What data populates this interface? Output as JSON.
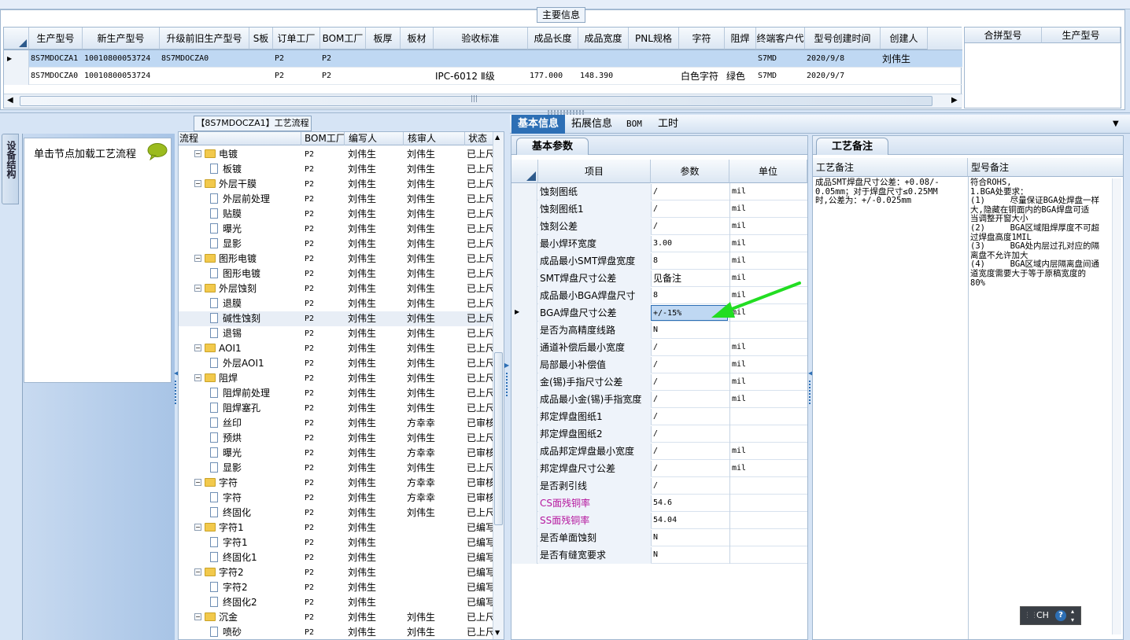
{
  "main": {
    "title": "主要信息",
    "columns": [
      "生产型号",
      "新生产型号",
      "升级前旧生产型号",
      "S板",
      "订单工厂",
      "BOM工厂",
      "板厚",
      "板材",
      "验收标准",
      "成品长度",
      "成品宽度",
      "PNL规格",
      "字符",
      "阻焊",
      "终端客户代码",
      "型号创建时间",
      "创建人"
    ],
    "rows": [
      [
        "8S7MDOCZA1",
        "10010800053724",
        "8S7MDOCZA0",
        "",
        "P2",
        "P2",
        "",
        "",
        "",
        "",
        "",
        "",
        "",
        "",
        "S7MD",
        "2020/9/8",
        "刘伟生"
      ],
      [
        "8S7MDOCZA0",
        "10010800053724",
        "",
        "",
        "P2",
        "P2",
        "",
        "",
        "IPC-6012 Ⅱ级",
        "177.000",
        "148.390",
        "",
        "白色字符",
        "绿色",
        "S7MD",
        "2020/9/7",
        ""
      ]
    ],
    "side_columns": [
      "合拼型号",
      "生产型号"
    ]
  },
  "left": {
    "vertical_tab": "设备结构",
    "hint": "单击节点加载工艺流程"
  },
  "tree": {
    "title": "【8S7MDOCZA1】工艺流程",
    "columns": [
      "流程",
      "BOM工厂",
      "编写人",
      "核审人",
      "状态"
    ],
    "rows": [
      {
        "level": 1,
        "type": "folder",
        "name": "电镀",
        "bom": "P2",
        "writer": "刘伟生",
        "reviewer": "刘伟生",
        "status": "已上尺"
      },
      {
        "level": 2,
        "type": "doc",
        "name": "板镀",
        "bom": "P2",
        "writer": "刘伟生",
        "reviewer": "刘伟生",
        "status": "已上尺"
      },
      {
        "level": 1,
        "type": "folder",
        "name": "外层干膜",
        "bom": "P2",
        "writer": "刘伟生",
        "reviewer": "刘伟生",
        "status": "已上尺"
      },
      {
        "level": 2,
        "type": "doc",
        "name": "外层前处理",
        "bom": "P2",
        "writer": "刘伟生",
        "reviewer": "刘伟生",
        "status": "已上尺"
      },
      {
        "level": 2,
        "type": "doc",
        "name": "贴膜",
        "bom": "P2",
        "writer": "刘伟生",
        "reviewer": "刘伟生",
        "status": "已上尺"
      },
      {
        "level": 2,
        "type": "doc",
        "name": "曝光",
        "bom": "P2",
        "writer": "刘伟生",
        "reviewer": "刘伟生",
        "status": "已上尺"
      },
      {
        "level": 2,
        "type": "doc",
        "name": "显影",
        "bom": "P2",
        "writer": "刘伟生",
        "reviewer": "刘伟生",
        "status": "已上尺"
      },
      {
        "level": 1,
        "type": "folder",
        "name": "图形电镀",
        "bom": "P2",
        "writer": "刘伟生",
        "reviewer": "刘伟生",
        "status": "已上尺"
      },
      {
        "level": 2,
        "type": "doc",
        "name": "图形电镀",
        "bom": "P2",
        "writer": "刘伟生",
        "reviewer": "刘伟生",
        "status": "已上尺"
      },
      {
        "level": 1,
        "type": "folder",
        "name": "外层蚀刻",
        "bom": "P2",
        "writer": "刘伟生",
        "reviewer": "刘伟生",
        "status": "已上尺"
      },
      {
        "level": 2,
        "type": "doc",
        "name": "退膜",
        "bom": "P2",
        "writer": "刘伟生",
        "reviewer": "刘伟生",
        "status": "已上尺"
      },
      {
        "level": 2,
        "type": "doc",
        "name": "碱性蚀刻",
        "bom": "P2",
        "writer": "刘伟生",
        "reviewer": "刘伟生",
        "status": "已上尺"
      },
      {
        "level": 2,
        "type": "doc",
        "name": "退锡",
        "bom": "P2",
        "writer": "刘伟生",
        "reviewer": "刘伟生",
        "status": "已上尺"
      },
      {
        "level": 1,
        "type": "folder",
        "name": "AOI1",
        "bom": "P2",
        "writer": "刘伟生",
        "reviewer": "刘伟生",
        "status": "已上尺"
      },
      {
        "level": 2,
        "type": "doc",
        "name": "外层AOI1",
        "bom": "P2",
        "writer": "刘伟生",
        "reviewer": "刘伟生",
        "status": "已上尺"
      },
      {
        "level": 1,
        "type": "folder",
        "name": "阻焊",
        "bom": "P2",
        "writer": "刘伟生",
        "reviewer": "刘伟生",
        "status": "已上尺"
      },
      {
        "level": 2,
        "type": "doc",
        "name": "阻焊前处理",
        "bom": "P2",
        "writer": "刘伟生",
        "reviewer": "刘伟生",
        "status": "已上尺"
      },
      {
        "level": 2,
        "type": "doc",
        "name": "阻焊塞孔",
        "bom": "P2",
        "writer": "刘伟生",
        "reviewer": "刘伟生",
        "status": "已上尺"
      },
      {
        "level": 2,
        "type": "doc",
        "name": "丝印",
        "bom": "P2",
        "writer": "刘伟生",
        "reviewer": "方幸幸",
        "status": "已审核"
      },
      {
        "level": 2,
        "type": "doc",
        "name": "预烘",
        "bom": "P2",
        "writer": "刘伟生",
        "reviewer": "刘伟生",
        "status": "已上尺"
      },
      {
        "level": 2,
        "type": "doc",
        "name": "曝光",
        "bom": "P2",
        "writer": "刘伟生",
        "reviewer": "方幸幸",
        "status": "已审核"
      },
      {
        "level": 2,
        "type": "doc",
        "name": "显影",
        "bom": "P2",
        "writer": "刘伟生",
        "reviewer": "刘伟生",
        "status": "已上尺"
      },
      {
        "level": 1,
        "type": "folder",
        "name": "字符",
        "bom": "P2",
        "writer": "刘伟生",
        "reviewer": "方幸幸",
        "status": "已审核"
      },
      {
        "level": 2,
        "type": "doc",
        "name": "字符",
        "bom": "P2",
        "writer": "刘伟生",
        "reviewer": "方幸幸",
        "status": "已审核"
      },
      {
        "level": 2,
        "type": "doc",
        "name": "终固化",
        "bom": "P2",
        "writer": "刘伟生",
        "reviewer": "刘伟生",
        "status": "已上尺"
      },
      {
        "level": 1,
        "type": "folder",
        "name": "字符1",
        "bom": "P2",
        "writer": "刘伟生",
        "reviewer": "",
        "status": "已编写"
      },
      {
        "level": 2,
        "type": "doc",
        "name": "字符1",
        "bom": "P2",
        "writer": "刘伟生",
        "reviewer": "",
        "status": "已编写"
      },
      {
        "level": 2,
        "type": "doc",
        "name": "终固化1",
        "bom": "P2",
        "writer": "刘伟生",
        "reviewer": "",
        "status": "已编写"
      },
      {
        "level": 1,
        "type": "folder",
        "name": "字符2",
        "bom": "P2",
        "writer": "刘伟生",
        "reviewer": "",
        "status": "已编写"
      },
      {
        "level": 2,
        "type": "doc",
        "name": "字符2",
        "bom": "P2",
        "writer": "刘伟生",
        "reviewer": "",
        "status": "已编写"
      },
      {
        "level": 2,
        "type": "doc",
        "name": "终固化2",
        "bom": "P2",
        "writer": "刘伟生",
        "reviewer": "",
        "status": "已编写"
      },
      {
        "level": 1,
        "type": "folder",
        "name": "沉金",
        "bom": "P2",
        "writer": "刘伟生",
        "reviewer": "刘伟生",
        "status": "已上尺"
      },
      {
        "level": 2,
        "type": "doc",
        "name": "喷砂",
        "bom": "P2",
        "writer": "刘伟生",
        "reviewer": "刘伟生",
        "status": "已上尺"
      }
    ]
  },
  "right_tabs": [
    "基本信息",
    "拓展信息",
    "BOM",
    "工时"
  ],
  "params": {
    "subtab": "基本参数",
    "columns": [
      "项目",
      "参数",
      "单位"
    ],
    "rows": [
      {
        "item": "蚀刻图纸",
        "value": "/",
        "unit": "mil",
        "pink": false
      },
      {
        "item": "蚀刻图纸1",
        "value": "/",
        "unit": "mil",
        "pink": false
      },
      {
        "item": "蚀刻公差",
        "value": "/",
        "unit": "mil",
        "pink": false
      },
      {
        "item": "最小焊环宽度",
        "value": "3.00",
        "unit": "mil",
        "pink": false
      },
      {
        "item": "成品最小SMT焊盘宽度",
        "value": "8",
        "unit": "mil",
        "pink": false
      },
      {
        "item": "SMT焊盘尺寸公差",
        "value": "见备注",
        "unit": "mil",
        "pink": false
      },
      {
        "item": "成品最小BGA焊盘尺寸",
        "value": "8",
        "unit": "mil",
        "pink": false
      },
      {
        "item": "BGA焊盘尺寸公差",
        "value": "+/-15%",
        "unit": "mil",
        "pink": false
      },
      {
        "item": "是否为高精度线路",
        "value": "N",
        "unit": "",
        "pink": false
      },
      {
        "item": "通道补偿后最小宽度",
        "value": "/",
        "unit": "mil",
        "pink": false
      },
      {
        "item": "局部最小补偿值",
        "value": "/",
        "unit": "mil",
        "pink": false
      },
      {
        "item": "金(锡)手指尺寸公差",
        "value": "/",
        "unit": "mil",
        "pink": false
      },
      {
        "item": "成品最小金(锡)手指宽度",
        "value": "/",
        "unit": "mil",
        "pink": false
      },
      {
        "item": "邦定焊盘图纸1",
        "value": "/",
        "unit": "",
        "pink": false
      },
      {
        "item": "邦定焊盘图纸2",
        "value": "/",
        "unit": "",
        "pink": false
      },
      {
        "item": "成品邦定焊盘最小宽度",
        "value": "/",
        "unit": "mil",
        "pink": false
      },
      {
        "item": "邦定焊盘尺寸公差",
        "value": "/",
        "unit": "mil",
        "pink": false
      },
      {
        "item": "是否剥引线",
        "value": "/",
        "unit": "",
        "pink": false
      },
      {
        "item": "CS面残铜率",
        "value": "54.6",
        "unit": "",
        "pink": true
      },
      {
        "item": "SS面残铜率",
        "value": "54.04",
        "unit": "",
        "pink": true
      },
      {
        "item": "是否单面蚀刻",
        "value": "N",
        "unit": "",
        "pink": false
      },
      {
        "item": "是否有缝宽要求",
        "value": "N",
        "unit": "",
        "pink": false
      }
    ]
  },
  "remarks": {
    "subtab": "工艺备注",
    "col1": "工艺备注",
    "col2": "型号备注",
    "process_remark": "成品SMT焊盘尺寸公差：+0.08/-\n0.05mm；对于焊盘尺寸≤0.25MM\n时,公差为：+/-0.025mm",
    "model_remark": "符合ROHS,\n1.BGA处要求：\n(1)     尽量保证BGA处焊盘一样\n大,隐藏在铜面内的BGA焊盘可适\n当调整开窗大小\n(2)     BGA区域阻焊厚度不可超\n过焊盘高度1MIL\n(3)     BGA处内层过孔对应的隔\n离盘不允许加大\n(4)     BGA区域内层隔离盘间通\n道宽度需要大于等于原稿宽度的\n80%"
  },
  "ime": {
    "label": "CH"
  },
  "colors": {
    "accent": "#2d6fb5",
    "selected_row": "#bfd8f3",
    "arrow": "#22dd22",
    "pink": "#b5179e"
  }
}
